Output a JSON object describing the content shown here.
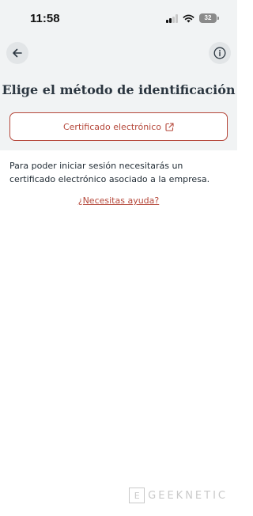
{
  "status_bar": {
    "time": "11:58",
    "battery": "32"
  },
  "header": {
    "back_icon": "arrow-left-icon",
    "info_icon": "info-icon",
    "title": "Elige el método de identificación"
  },
  "options": {
    "cert_label": "Certificado electrónico",
    "cert_icon": "external-link-icon"
  },
  "body": {
    "description": "Para poder iniciar sesión necesitarás un certificado electrónico asociado a la empresa.",
    "help_link": "¿Necesitas ayuda?"
  },
  "watermark": {
    "mark": "E",
    "text": "GEEKNETIC"
  },
  "colors": {
    "accent": "#b5473a",
    "header_bg": "#f1f3f4",
    "text": "#1f2a33"
  }
}
